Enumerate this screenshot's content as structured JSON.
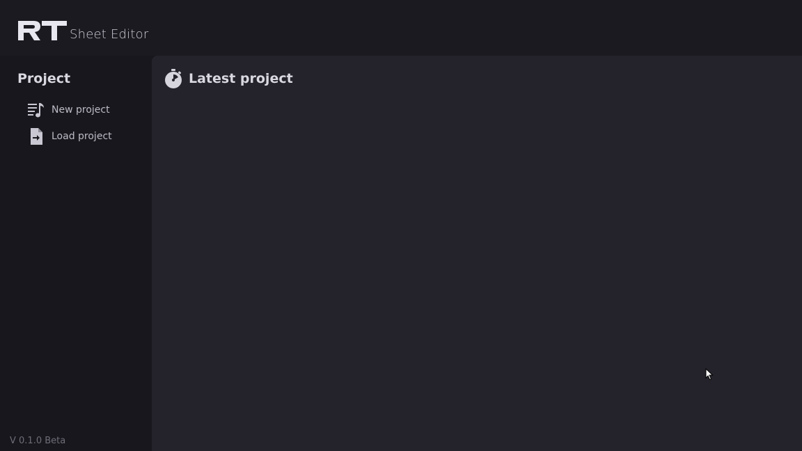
{
  "header": {
    "logo_text": "Sheet Editor",
    "logo_mark_icon": "rt-logo-icon"
  },
  "sidebar": {
    "title": "Project",
    "items": [
      {
        "label": "New project",
        "icon": "music-list-icon"
      },
      {
        "label": "Load project",
        "icon": "file-import-icon"
      }
    ],
    "version": "V 0.1.0 Beta"
  },
  "main": {
    "title": "Latest project",
    "icon": "stopwatch-icon"
  },
  "colors": {
    "background": "#18171d",
    "panel": "#24232b",
    "text": "#d9d7e0",
    "muted": "#6f6d78"
  }
}
